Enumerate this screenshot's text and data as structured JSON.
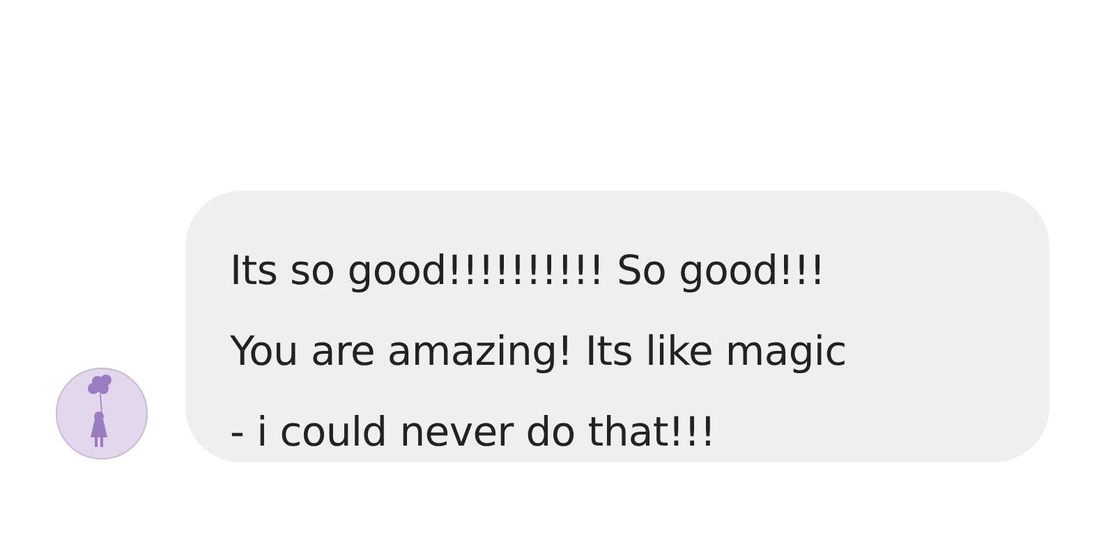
{
  "message": {
    "lines": [
      "Its so good!!!!!!!!!! So good!!!",
      "You are amazing! Its like magic",
      "- i could never do that!!!"
    ]
  }
}
